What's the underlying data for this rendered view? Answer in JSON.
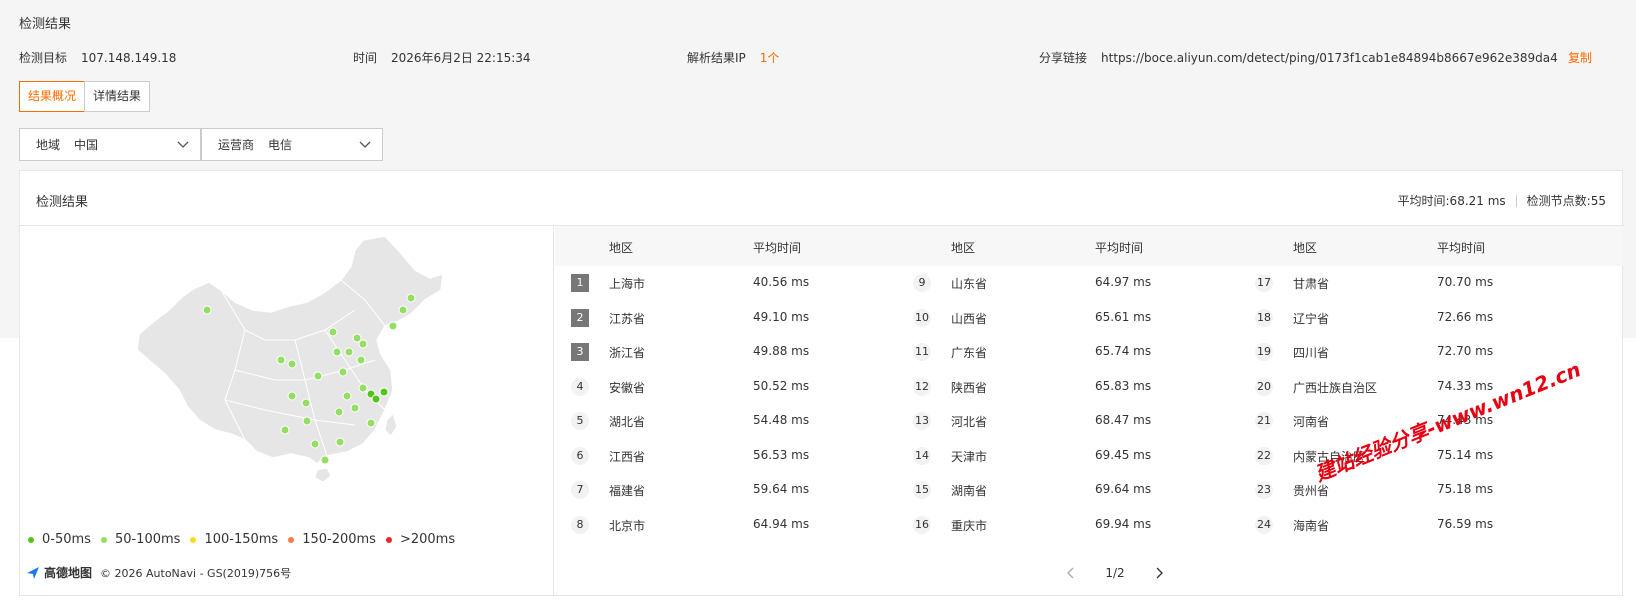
{
  "header": {
    "title": "检测结果",
    "target_label": "检测目标",
    "target_value": "107.148.149.18",
    "time_label": "时间",
    "time_value": "2026年6月2日 22:15:34",
    "ip_label": "解析结果IP",
    "ip_value": "1个",
    "share_label": "分享链接",
    "share_url": "https://boce.aliyun.com/detect/ping/0173f1cab1e84894b8667e962e389da4",
    "copy_label": "复制"
  },
  "tabs": [
    {
      "label": "结果概况",
      "active": true
    },
    {
      "label": "详情结果",
      "active": false
    }
  ],
  "filters": {
    "region_label": "地域",
    "region_value": "中国",
    "isp_label": "运营商",
    "isp_value": "电信"
  },
  "panel": {
    "title": "检测结果",
    "avg_time": "平均时间:68.21 ms",
    "node_count": "检测节点数:55"
  },
  "table": {
    "col_region": "地区",
    "col_time": "平均时间",
    "rows": [
      {
        "rank": "1",
        "region": "上海市",
        "time": "40.56 ms"
      },
      {
        "rank": "2",
        "region": "江苏省",
        "time": "49.10 ms"
      },
      {
        "rank": "3",
        "region": "浙江省",
        "time": "49.88 ms"
      },
      {
        "rank": "4",
        "region": "安徽省",
        "time": "50.52 ms"
      },
      {
        "rank": "5",
        "region": "湖北省",
        "time": "54.48 ms"
      },
      {
        "rank": "6",
        "region": "江西省",
        "time": "56.53 ms"
      },
      {
        "rank": "7",
        "region": "福建省",
        "time": "59.64 ms"
      },
      {
        "rank": "8",
        "region": "北京市",
        "time": "64.94 ms"
      },
      {
        "rank": "9",
        "region": "山东省",
        "time": "64.97 ms"
      },
      {
        "rank": "10",
        "region": "山西省",
        "time": "65.61 ms"
      },
      {
        "rank": "11",
        "region": "广东省",
        "time": "65.74 ms"
      },
      {
        "rank": "12",
        "region": "陕西省",
        "time": "65.83 ms"
      },
      {
        "rank": "13",
        "region": "河北省",
        "time": "68.47 ms"
      },
      {
        "rank": "14",
        "region": "天津市",
        "time": "69.45 ms"
      },
      {
        "rank": "15",
        "region": "湖南省",
        "time": "69.64 ms"
      },
      {
        "rank": "16",
        "region": "重庆市",
        "time": "69.94 ms"
      },
      {
        "rank": "17",
        "region": "甘肃省",
        "time": "70.70 ms"
      },
      {
        "rank": "18",
        "region": "辽宁省",
        "time": "72.66 ms"
      },
      {
        "rank": "19",
        "region": "四川省",
        "time": "72.70 ms"
      },
      {
        "rank": "20",
        "region": "广西壮族自治区",
        "time": "74.33 ms"
      },
      {
        "rank": "21",
        "region": "河南省",
        "time": "74.43 ms"
      },
      {
        "rank": "22",
        "region": "内蒙古自治区",
        "time": "75.14 ms"
      },
      {
        "rank": "23",
        "region": "贵州省",
        "time": "75.18 ms"
      },
      {
        "rank": "24",
        "region": "海南省",
        "time": "76.59 ms"
      }
    ]
  },
  "legend": [
    {
      "label": "0-50ms",
      "color": "#52c41a"
    },
    {
      "label": "50-100ms",
      "color": "#95de64"
    },
    {
      "label": "100-150ms",
      "color": "#fadb14"
    },
    {
      "label": "150-200ms",
      "color": "#ff7a45"
    },
    {
      "label": ">200ms",
      "color": "#f5222d"
    }
  ],
  "map_credit": {
    "logo": "高德地图",
    "copyright": "© 2026 AutoNavi - GS(2019)756号"
  },
  "pagination": {
    "current": "1/2"
  },
  "watermark": "建站经验分享-www.wn12.cn"
}
